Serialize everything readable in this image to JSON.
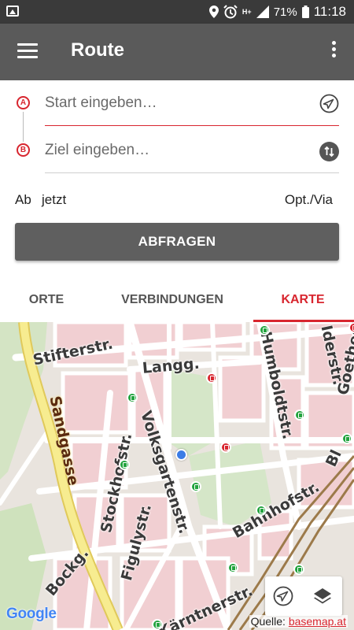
{
  "status_bar": {
    "battery": "71%",
    "time": "11:18",
    "network": "H+",
    "icons": [
      "gallery-icon",
      "location-icon",
      "alarm-icon",
      "signal-icon",
      "battery-icon"
    ]
  },
  "app_bar": {
    "title": "Route",
    "menu_icon": "hamburger-menu-icon",
    "overflow_icon": "more-vert-icon",
    "background": "#5a5a5a"
  },
  "form": {
    "start_marker": "A",
    "destination_marker": "B",
    "start_placeholder": "Start eingeben…",
    "start_value": "",
    "destination_placeholder": "Ziel eingeben…",
    "destination_value": "",
    "locate_icon": "navigation-arrow-icon",
    "swap_icon": "swap-vertical-icon",
    "departure_label": "Ab",
    "departure_value": "jetzt",
    "options_label": "Opt./Via",
    "query_button": "ABFRAGEN",
    "accent": "#d8262f"
  },
  "tabs": [
    {
      "label": "ORTE",
      "active": false
    },
    {
      "label": "VERBINDUNGEN",
      "active": false
    },
    {
      "label": "KARTE",
      "active": true
    }
  ],
  "map": {
    "street_labels": [
      "Stifterstr.",
      "Langg.",
      "Humboldtstr.",
      "Sandgasse",
      "Volksgartenstr.",
      "Stockhofstr.",
      "Figulystr.",
      "Bahnhofstr.",
      "Bockg.",
      "Kärntnerstr.",
      "Goethestr.",
      "Bl",
      "Iderstr."
    ],
    "stop_icons": [
      "tram-stop-icon",
      "bus-stop-icon"
    ],
    "google_logo": "Google",
    "attribution_prefix": "Quelle:",
    "attribution_link": "basemap.at",
    "controls": [
      "my-location-icon",
      "layers-icon"
    ]
  }
}
